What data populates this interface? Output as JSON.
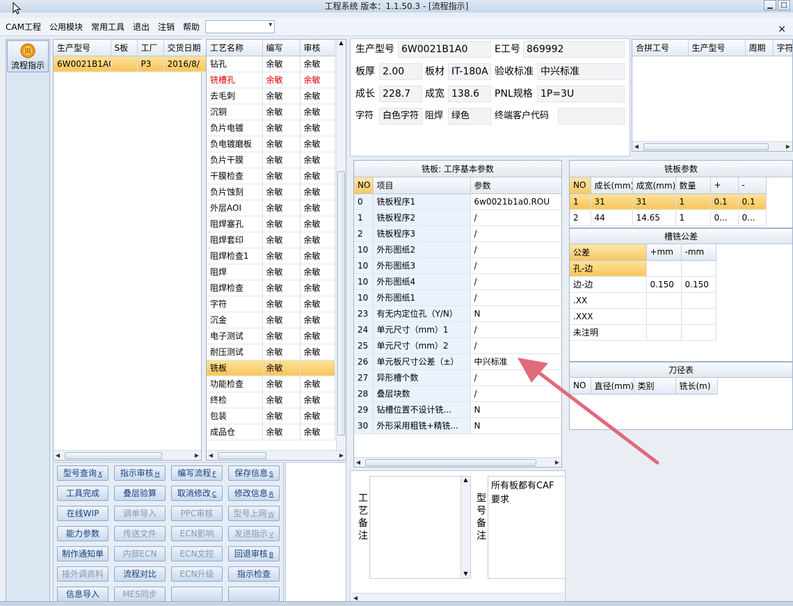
{
  "window": {
    "title": "工程系统  版本：1.1.50.3 - [流程指示]",
    "btn_min": "▁",
    "btn_max": "□"
  },
  "menu": {
    "items": [
      "CAM工程",
      "公用模块",
      "常用工具",
      "退出",
      "注销",
      "帮助"
    ],
    "dropdown_arrow": "▾",
    "close": "×"
  },
  "sidebar": {
    "label": "流程指示"
  },
  "model_list": {
    "headers": [
      "生产型号",
      "S板",
      "工厂",
      "交货日期"
    ],
    "rows": [
      [
        "6W0021B1A0",
        "",
        "P3",
        "2016/8/"
      ]
    ]
  },
  "process": {
    "headers": [
      "工艺名称",
      "编写",
      "审核"
    ],
    "rows": [
      {
        "name": "钻孔",
        "writer": "余敏",
        "reviewer": "余敏"
      },
      {
        "name": "铣槽孔",
        "writer": "余敏",
        "reviewer": "余敏",
        "red": true
      },
      {
        "name": "去毛刺",
        "writer": "余敏",
        "reviewer": "余敏"
      },
      {
        "name": "沉铜",
        "writer": "余敏",
        "reviewer": "余敏"
      },
      {
        "name": "负片电镀",
        "writer": "余敏",
        "reviewer": "余敏"
      },
      {
        "name": "负电镀磨板",
        "writer": "余敏",
        "reviewer": "余敏"
      },
      {
        "name": "负片干膜",
        "writer": "余敏",
        "reviewer": "余敏"
      },
      {
        "name": "干膜检查",
        "writer": "余敏",
        "reviewer": "余敏"
      },
      {
        "name": "负片蚀刻",
        "writer": "余敏",
        "reviewer": "余敏"
      },
      {
        "name": "外层AOI",
        "writer": "余敏",
        "reviewer": "余敏"
      },
      {
        "name": "阻焊塞孔",
        "writer": "余敏",
        "reviewer": "余敏"
      },
      {
        "name": "阻焊套印",
        "writer": "余敏",
        "reviewer": "余敏"
      },
      {
        "name": "阻焊检查1",
        "writer": "余敏",
        "reviewer": "余敏"
      },
      {
        "name": "阻焊",
        "writer": "余敏",
        "reviewer": "余敏"
      },
      {
        "name": "阻焊检查",
        "writer": "余敏",
        "reviewer": "余敏"
      },
      {
        "name": "字符",
        "writer": "余敏",
        "reviewer": "余敏"
      },
      {
        "name": "沉金",
        "writer": "余敏",
        "reviewer": "余敏"
      },
      {
        "name": "电子测试",
        "writer": "余敏",
        "reviewer": "余敏"
      },
      {
        "name": "耐压测试",
        "writer": "余敏",
        "reviewer": "余敏"
      },
      {
        "name": "铣板",
        "writer": "余敏",
        "reviewer": "",
        "selected": true
      },
      {
        "name": "功能检查",
        "writer": "余敏",
        "reviewer": "余敏"
      },
      {
        "name": "终检",
        "writer": "余敏",
        "reviewer": "余敏"
      },
      {
        "name": "包装",
        "writer": "余敏",
        "reviewer": "余敏"
      },
      {
        "name": "成品仓",
        "writer": "余敏",
        "reviewer": "余敏"
      }
    ]
  },
  "buttons": [
    {
      "label": "型号查询",
      "key": "X",
      "enabled": true
    },
    {
      "label": "指示审核",
      "key": "H",
      "enabled": true
    },
    {
      "label": "编写流程",
      "key": "F",
      "enabled": true
    },
    {
      "label": "保存信息",
      "key": "S",
      "enabled": true
    },
    {
      "label": "工具完成",
      "key": "",
      "enabled": true
    },
    {
      "label": "叠层验算",
      "key": "",
      "enabled": true
    },
    {
      "label": "取消修改",
      "key": "C",
      "enabled": true
    },
    {
      "label": "修改信息",
      "key": "R",
      "enabled": true
    },
    {
      "label": "在线WIP",
      "key": "",
      "enabled": true
    },
    {
      "label": "调单导入",
      "key": "",
      "enabled": false
    },
    {
      "label": "PPC审核",
      "key": "",
      "enabled": false
    },
    {
      "label": "型号上网",
      "key": "W",
      "enabled": false
    },
    {
      "label": "能力参数",
      "key": "",
      "enabled": true
    },
    {
      "label": "传送文件",
      "key": "",
      "enabled": false
    },
    {
      "label": "ECN影响",
      "key": "",
      "enabled": false
    },
    {
      "label": "发送指示",
      "key": "V",
      "enabled": false
    },
    {
      "label": "制作通知单",
      "key": "",
      "enabled": true
    },
    {
      "label": "内部ECN",
      "key": "",
      "enabled": false
    },
    {
      "label": "ECN文控",
      "key": "",
      "enabled": false
    },
    {
      "label": "回退审核",
      "key": "B",
      "enabled": true
    },
    {
      "label": "接外调资料",
      "key": "",
      "enabled": false
    },
    {
      "label": "流程对比",
      "key": "",
      "enabled": true
    },
    {
      "label": "ECN升级",
      "key": "",
      "enabled": false
    },
    {
      "label": "指示检查",
      "key": "",
      "enabled": true
    },
    {
      "label": "信息导入",
      "key": "",
      "enabled": true
    },
    {
      "label": "MES同步",
      "key": "",
      "enabled": false
    },
    {
      "label": "",
      "key": "",
      "enabled": true
    },
    {
      "label": "",
      "key": "",
      "enabled": true
    }
  ],
  "info": {
    "model_label": "生产型号",
    "model": "6W0021B1A0",
    "e_label": "E工号",
    "e_no": "869992",
    "thick_label": "板厚",
    "thick": "2.00",
    "mat_label": "板材",
    "mat": "IT-180A",
    "std_label": "验收标准",
    "std": "中兴标准",
    "len_label": "成长",
    "len": "228.7",
    "wid_label": "成宽",
    "wid": "138.6",
    "pnl_label": "PNL规格",
    "pnl": "1P=3U",
    "char_label": "字符",
    "char": "白色字符",
    "mask_label": "阻焊",
    "mask": "绿色",
    "cust_label": "终端客户代码",
    "cust": ""
  },
  "merge": {
    "headers": [
      "合拼工号",
      "生产型号",
      "周期",
      "字符"
    ]
  },
  "params": {
    "title": "铣板: 工序基本参数",
    "headers": [
      "NO",
      "项目",
      "参数"
    ],
    "rows": [
      [
        "0",
        "铣板程序1",
        "6w0021b1a0.ROU"
      ],
      [
        "1",
        "铣板程序2",
        "/"
      ],
      [
        "2",
        "铣板程序3",
        "/"
      ],
      [
        "10",
        "外形图纸2",
        "/"
      ],
      [
        "10",
        "外形图纸3",
        "/"
      ],
      [
        "10",
        "外形图纸4",
        "/"
      ],
      [
        "10",
        "外形图纸1",
        "/"
      ],
      [
        "23",
        "有无内定位孔（Y/N）",
        "N"
      ],
      [
        "24",
        "单元尺寸（mm）1",
        "/"
      ],
      [
        "25",
        "单元尺寸（mm）2",
        "/"
      ],
      [
        "26",
        "单元板尺寸公差（±）",
        "中兴标准"
      ],
      [
        "27",
        "异形槽个数",
        "/"
      ],
      [
        "28",
        "叠层块数",
        "/"
      ],
      [
        "29",
        "钻槽位置不设计铣...",
        "N"
      ],
      [
        "30",
        "外形采用粗铣+精铣...",
        "N"
      ]
    ]
  },
  "mill": {
    "title": "铣板参数",
    "headers": [
      "NO",
      "成长(mm)",
      "成宽(mm)",
      "数量",
      "+",
      "-"
    ],
    "rows": [
      [
        "1",
        "31",
        "31",
        "1",
        "0.1",
        "0.1"
      ],
      [
        "2",
        "44",
        "14.65",
        "1",
        "0...",
        "0..."
      ]
    ]
  },
  "tol": {
    "title": "槽铣公差",
    "headers": [
      "公差",
      "+mm",
      "-mm"
    ],
    "rows": [
      [
        "孔-边",
        "",
        ""
      ],
      [
        "边-边",
        "0.150",
        "0.150"
      ],
      [
        ".XX",
        "",
        ""
      ],
      [
        ".XXX",
        "",
        ""
      ],
      [
        "未注明",
        "",
        ""
      ]
    ]
  },
  "tool": {
    "title": "刀径表",
    "headers": [
      "NO",
      "直径(mm)",
      "类别",
      "铣长(m)"
    ]
  },
  "remarks": {
    "process_label": "工艺备注",
    "model_label": "型号备注",
    "model_text": "所有板都有CAF要求"
  }
}
